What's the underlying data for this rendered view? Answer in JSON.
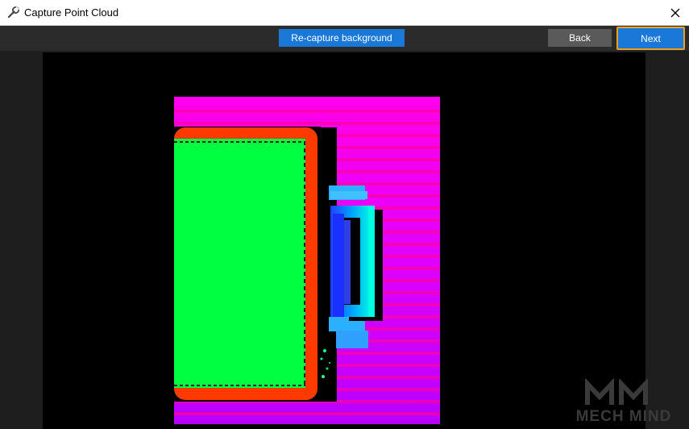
{
  "window": {
    "title": "Capture Point Cloud",
    "icon": "wrench-icon",
    "close_icon": "close-icon"
  },
  "toolbar": {
    "recapture_label": "Re-capture background",
    "back_label": "Back",
    "next_label": "Next"
  },
  "viewport": {
    "image": "point-cloud-depth-map",
    "watermark": "MECH MIND"
  },
  "colors": {
    "primary_button": "#1a78d8",
    "secondary_button": "#5a5a5a",
    "focus_border": "#f0a020",
    "toolbar_bg": "#2b2b2b",
    "background_plane": "#e000ff",
    "object_top": "#00ff40",
    "object_edge": "#ff3a00",
    "handle": "#00e0ff"
  }
}
